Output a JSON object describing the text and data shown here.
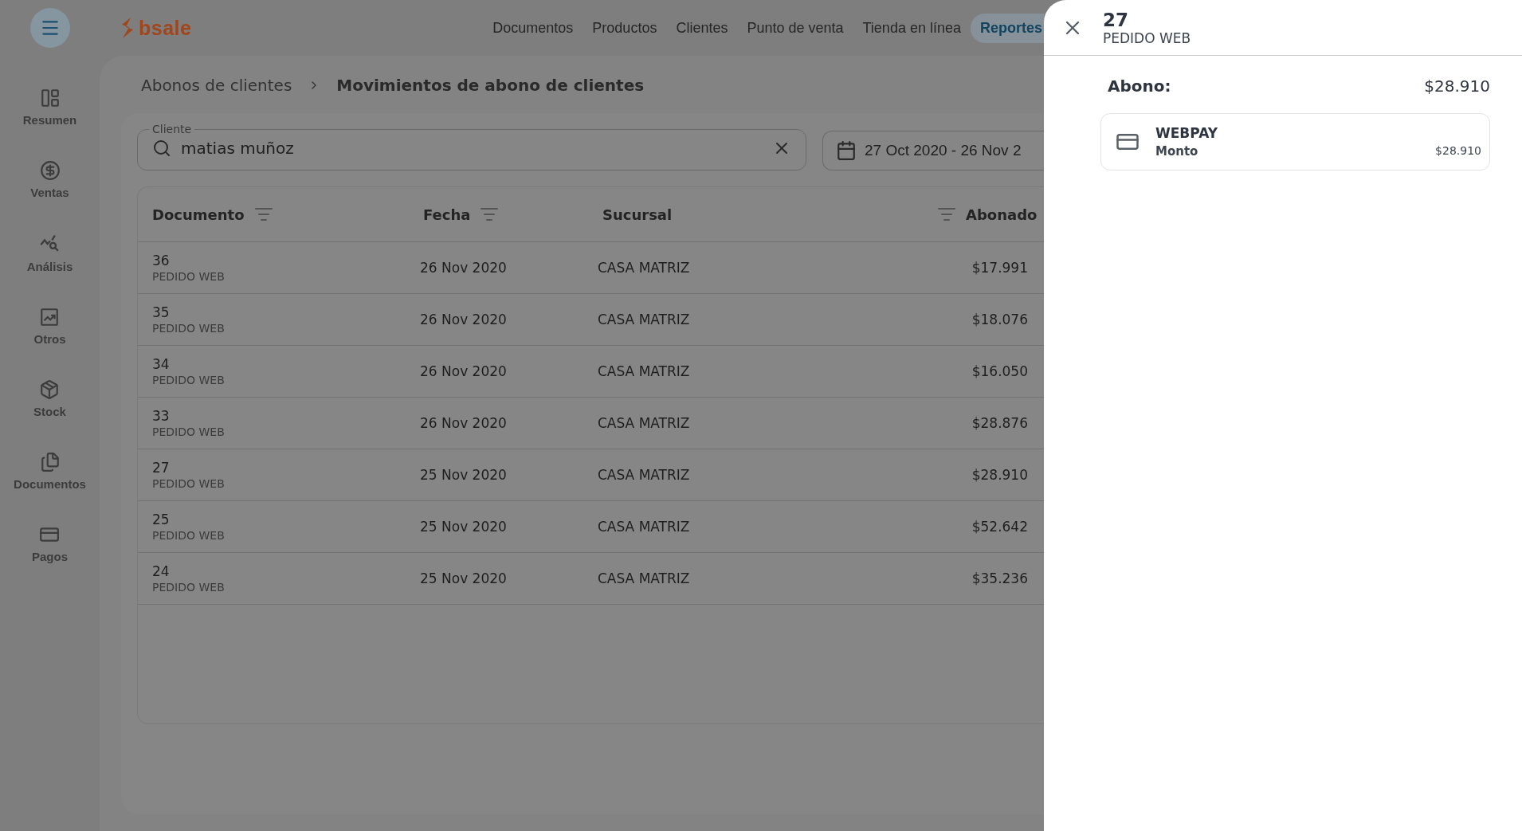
{
  "app": {
    "logo": "bsale"
  },
  "nav": [
    {
      "label": "Documentos",
      "selected": false
    },
    {
      "label": "Productos",
      "selected": false
    },
    {
      "label": "Clientes",
      "selected": false
    },
    {
      "label": "Punto de venta",
      "selected": false
    },
    {
      "label": "Tienda en línea",
      "selected": false
    },
    {
      "label": "Reportes",
      "selected": true
    }
  ],
  "sidebar": {
    "items": [
      {
        "label": "Resumen",
        "kind": "resumen"
      },
      {
        "label": "Ventas",
        "kind": "ventas"
      },
      {
        "label": "Análisis",
        "kind": "analisis"
      },
      {
        "label": "Otros",
        "kind": "otros"
      },
      {
        "label": "Stock",
        "kind": "stock"
      },
      {
        "label": "Documentos",
        "kind": "documentos"
      },
      {
        "label": "Pagos",
        "kind": "pagos"
      }
    ]
  },
  "breadcrumb": [
    {
      "label": "Abonos de clientes"
    },
    {
      "label": "Movimientos de abono de clientes"
    }
  ],
  "filters": {
    "client": {
      "label": "Cliente",
      "value": "matias muñoz"
    },
    "date_range": {
      "value": "27 Oct 2020 - 26 Nov 2"
    }
  },
  "table": {
    "columns": [
      {
        "label": "Documento",
        "sortable": true,
        "numeric": false
      },
      {
        "label": "Fecha",
        "sortable": true,
        "numeric": false
      },
      {
        "label": "Sucursal",
        "sortable": false,
        "numeric": false
      },
      {
        "label": "Abonado",
        "sortable": true,
        "numeric": true
      }
    ],
    "rows": [
      {
        "number": "36",
        "type": "PEDIDO WEB",
        "date": "26 Nov 2020",
        "branch": "CASA MATRIZ",
        "amount": "$17.991"
      },
      {
        "number": "35",
        "type": "PEDIDO WEB",
        "date": "26 Nov 2020",
        "branch": "CASA MATRIZ",
        "amount": "$18.076"
      },
      {
        "number": "34",
        "type": "PEDIDO WEB",
        "date": "26 Nov 2020",
        "branch": "CASA MATRIZ",
        "amount": "$16.050"
      },
      {
        "number": "33",
        "type": "PEDIDO WEB",
        "date": "26 Nov 2020",
        "branch": "CASA MATRIZ",
        "amount": "$28.876"
      },
      {
        "number": "27",
        "type": "PEDIDO WEB",
        "date": "25 Nov 2020",
        "branch": "CASA MATRIZ",
        "amount": "$28.910"
      },
      {
        "number": "25",
        "type": "PEDIDO WEB",
        "date": "25 Nov 2020",
        "branch": "CASA MATRIZ",
        "amount": "$52.642"
      },
      {
        "number": "24",
        "type": "PEDIDO WEB",
        "date": "25 Nov 2020",
        "branch": "CASA MATRIZ",
        "amount": "$35.236"
      }
    ]
  },
  "drawer": {
    "title": "27",
    "subtitle": "PEDIDO WEB",
    "total_label": "Abono:",
    "total_value": "$28.910",
    "payments": [
      {
        "method": "WEBPAY",
        "label": "Monto",
        "amount": "$28.910"
      }
    ]
  }
}
